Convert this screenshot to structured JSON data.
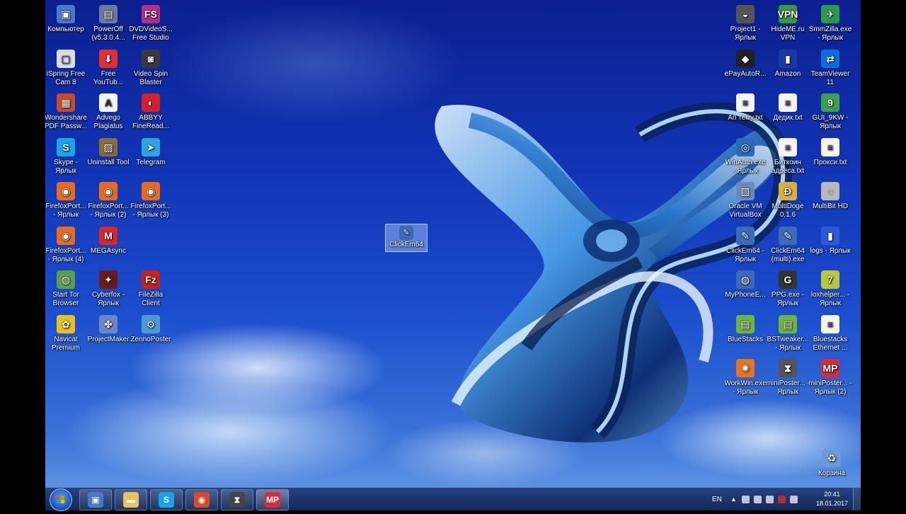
{
  "desktop_icons_left": [
    {
      "label": "Компьютер",
      "icon": "computer-icon",
      "color": "#4a78c4",
      "glyph": "▣"
    },
    {
      "label": "PowerOff (v5.3.0.4...",
      "icon": "poweroff-icon",
      "color": "#6a7a9a",
      "glyph": "▤"
    },
    {
      "label": "DVDVideoS... Free Studio",
      "icon": "dvdvideosoft-icon",
      "color": "#b0308a",
      "glyph": "FS"
    },
    {
      "label": "iSpring Free Cam 8",
      "icon": "ispring-icon",
      "color": "#d8dde6",
      "glyph": "▢"
    },
    {
      "label": "Free YouTub...",
      "icon": "download-icon",
      "color": "#e03030",
      "glyph": "⬇"
    },
    {
      "label": "Video Spin Blaster",
      "icon": "video-spin-icon",
      "color": "#3a3a3a",
      "glyph": "◙"
    },
    {
      "label": "Wondershare PDF Passw...",
      "icon": "wondershare-icon",
      "color": "#c84a2a",
      "glyph": "▦"
    },
    {
      "label": "Advego Plagiatus",
      "icon": "advego-icon",
      "color": "#f4f4f4",
      "glyph": "A"
    },
    {
      "label": "ABBYY FineRead...",
      "icon": "abbyy-icon",
      "color": "#d0202a",
      "glyph": "◐"
    },
    {
      "label": "Skype - Ярлык",
      "icon": "skype-icon",
      "color": "#1aa3e6",
      "glyph": "S"
    },
    {
      "label": "Uninstall Tool",
      "icon": "uninstall-icon",
      "color": "#8a6a3a",
      "glyph": "▨"
    },
    {
      "label": "Telegram",
      "icon": "telegram-icon",
      "color": "#2ea3dc",
      "glyph": "➤"
    },
    {
      "label": "FirefoxPort... - Ярлык",
      "icon": "firefox-icon",
      "color": "#e86a1a",
      "glyph": "◉"
    },
    {
      "label": "FirefoxPort... - Ярлык (2)",
      "icon": "firefox-icon",
      "color": "#e86a1a",
      "glyph": "◉"
    },
    {
      "label": "FirefoxPort... - Ярлык (3)",
      "icon": "firefox-icon",
      "color": "#e86a1a",
      "glyph": "◉"
    },
    {
      "label": "FirefoxPort... - Ярлык (4)",
      "icon": "firefox-icon",
      "color": "#e86a1a",
      "glyph": "◉"
    },
    {
      "label": "MEGAsync",
      "icon": "mega-icon",
      "color": "#d9272e",
      "glyph": "M"
    },
    {
      "label": "",
      "icon": "",
      "color": "",
      "glyph": ""
    },
    {
      "label": "Start Tor Browser",
      "icon": "tor-icon",
      "color": "#5aa04a",
      "glyph": "◍"
    },
    {
      "label": "Cyberfox - Ярлык",
      "icon": "cyberfox-icon",
      "color": "#6a1a1a",
      "glyph": "✦"
    },
    {
      "label": "FileZilla Client",
      "icon": "filezilla-icon",
      "color": "#c8201a",
      "glyph": "Fz"
    },
    {
      "label": "Navicat Premium",
      "icon": "navicat-icon",
      "color": "#e8c21a",
      "glyph": "✿"
    },
    {
      "label": "ProjectMaker",
      "icon": "projectmaker-icon",
      "color": "#6a86c8",
      "glyph": "✤"
    },
    {
      "label": "ZennoPoster",
      "icon": "zennoposter-icon",
      "color": "#4a9ad8",
      "glyph": "⚙"
    }
  ],
  "desktop_icons_right": [
    {
      "label": "Project1 - Ярлык",
      "icon": "project1-icon",
      "color": "#555",
      "glyph": "◒"
    },
    {
      "label": "HideME.ru VPN",
      "icon": "hideme-icon",
      "color": "#3a9a3a",
      "glyph": "VPN"
    },
    {
      "label": "SmmZilla.exe - Ярлык",
      "icon": "smmzilla-icon",
      "color": "#2a9a4a",
      "glyph": "✈"
    },
    {
      "label": "ePayAutoR...",
      "icon": "epay-icon",
      "color": "#222",
      "glyph": "◆"
    },
    {
      "label": "Amazon",
      "icon": "amazon-icon",
      "color": "#1a3aa0",
      "glyph": "▮"
    },
    {
      "label": "TeamViewer 11",
      "icon": "teamviewer-icon",
      "color": "#0a6fd8",
      "glyph": "⇄"
    },
    {
      "label": "Ап темy.txt",
      "icon": "text-file-icon",
      "color": "#f4f4f4",
      "glyph": "≡"
    },
    {
      "label": "Дедик.txt",
      "icon": "text-file-icon",
      "color": "#f4f4f4",
      "glyph": "≡"
    },
    {
      "label": "GUI_9KW - Ярлык",
      "icon": "gui9kw-icon",
      "color": "#3aa04a",
      "glyph": "9"
    },
    {
      "label": "WinAuth.exe - Ярлык",
      "icon": "winauth-icon",
      "color": "#2a6ab8",
      "glyph": "◎"
    },
    {
      "label": "Биткоин адреса.txt",
      "icon": "text-file-icon",
      "color": "#f4f4f4",
      "glyph": "≡"
    },
    {
      "label": "Прокси.txt",
      "icon": "text-file-icon",
      "color": "#f4f4f4",
      "glyph": "≡"
    },
    {
      "label": "Oracle VM VirtualBox",
      "icon": "virtualbox-icon",
      "color": "#6a8ab8",
      "glyph": "▧"
    },
    {
      "label": "MultiDoge 0.1.6",
      "icon": "multidoge-icon",
      "color": "#d8b03a",
      "glyph": "Ð"
    },
    {
      "label": "MultiBit HD",
      "icon": "multibit-icon",
      "color": "#b8b8b8",
      "glyph": "◌"
    },
    {
      "label": "ClickEm64 - Ярлык",
      "icon": "clickem-icon",
      "color": "#3a6ab8",
      "glyph": "✎"
    },
    {
      "label": "ClickEm64 (multi).exe",
      "icon": "clickem-icon",
      "color": "#3a6ab8",
      "glyph": "✎"
    },
    {
      "label": "logs - Ярлык",
      "icon": "folder-blue-icon",
      "color": "#2a5ad8",
      "glyph": "▮"
    },
    {
      "label": "MyPhoneE...",
      "icon": "myphone-icon",
      "color": "#3a6ab8",
      "glyph": "◍"
    },
    {
      "label": "PPG.exe - Ярлык",
      "icon": "ppg-icon",
      "color": "#333",
      "glyph": "G"
    },
    {
      "label": "loxhelper... - Ярлык",
      "icon": "loxhelper-icon",
      "color": "#b8c83a",
      "glyph": "7"
    },
    {
      "label": "BlueStacks",
      "icon": "bluestacks-icon",
      "color": "#6ab83a",
      "glyph": "▤"
    },
    {
      "label": "BSTweaker... - Ярлык",
      "icon": "bstweaker-icon",
      "color": "#6ab83a",
      "glyph": "▤"
    },
    {
      "label": "Bluestacks Ethernet ...",
      "icon": "text-file-icon",
      "color": "#f4f4f4",
      "glyph": "≡"
    },
    {
      "label": "WorkWin.exe - Ярлык",
      "icon": "workwin-icon",
      "color": "#e8741a",
      "glyph": "✺"
    },
    {
      "label": "miniPoster... - Ярлык",
      "icon": "hourglass-icon",
      "color": "#555",
      "glyph": "⧗"
    },
    {
      "label": "miniPoster... - Ярлык (2)",
      "icon": "miniposter-icon",
      "color": "#d82a3a",
      "glyph": "MP"
    }
  ],
  "selected_icon": {
    "label": "ClickEm64",
    "icon": "clickem-icon",
    "color": "#3a6ab8",
    "glyph": "✎"
  },
  "recycle_bin": {
    "label": "Корзина",
    "icon": "recycle-bin-icon",
    "color": "#6a9ad8",
    "glyph": "♻"
  },
  "taskbar": {
    "buttons": [
      {
        "name": "computer",
        "icon": "computer-icon",
        "glyph": "▣",
        "color": "#4a78c4"
      },
      {
        "name": "explorer",
        "icon": "folder-icon",
        "glyph": "▬",
        "color": "#e8c25a"
      },
      {
        "name": "skype",
        "icon": "skype-icon",
        "glyph": "S",
        "color": "#1aa3e6"
      },
      {
        "name": "chrome",
        "icon": "chrome-icon",
        "glyph": "◉",
        "color": "#d84a2a"
      },
      {
        "name": "hourglass",
        "icon": "hourglass-icon",
        "glyph": "⧗",
        "color": "#444"
      },
      {
        "name": "miniposter",
        "icon": "miniposter-icon",
        "glyph": "MP",
        "color": "#d82a3a"
      }
    ],
    "language": "EN",
    "time": "20:41",
    "date": "18.01.2017"
  }
}
